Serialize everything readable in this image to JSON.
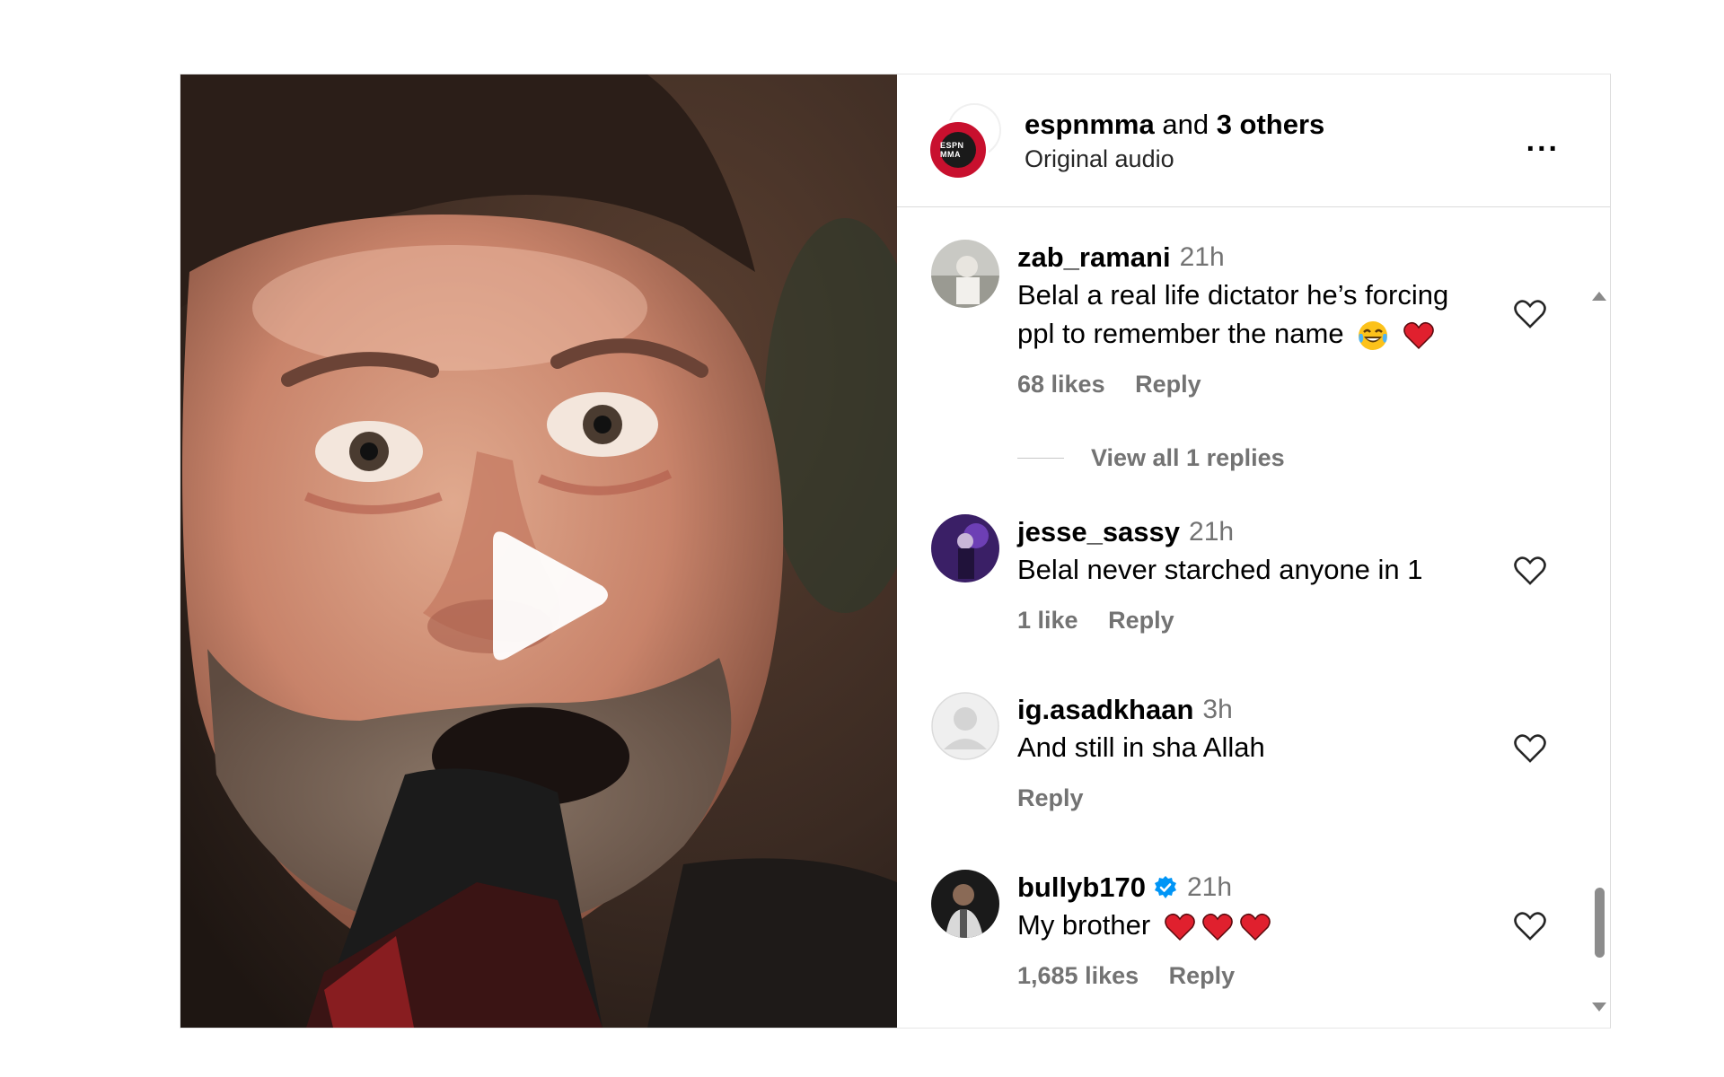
{
  "header": {
    "owner": "espnmma",
    "owner_joiner": " and ",
    "others": "3 others",
    "audio": "Original audio",
    "avatar_label": "ESPN MMA",
    "more_label": "..."
  },
  "media": {
    "play_label": "play"
  },
  "comments": [
    {
      "username": "zab_ramani",
      "time": "21h",
      "text_line1": "Belal a real life dictator he’s forcing",
      "text_line2": "ppl to remember the name",
      "emojis": [
        "laughing-tears",
        "red-heart"
      ],
      "likes": "68 likes",
      "reply": "Reply",
      "verified": false
    },
    {
      "username": "jesse_sassy",
      "time": "21h",
      "text_line1": "Belal never starched anyone in 1",
      "likes": "1 like",
      "reply": "Reply",
      "verified": false
    },
    {
      "username": "ig.asadkhaan",
      "time": "3h",
      "text_line1": "And still in sha Allah",
      "reply": "Reply",
      "verified": false
    },
    {
      "username": "bullyb170",
      "time": "21h",
      "text_line1": "My brother",
      "emojis": [
        "red-heart",
        "red-heart",
        "red-heart"
      ],
      "likes": "1,685 likes",
      "reply": "Reply",
      "verified": true
    }
  ],
  "view_replies": "View all 1 replies",
  "colors": {
    "muted": "#737373",
    "verified": "#0095f6",
    "espn_red": "#c8102e"
  }
}
